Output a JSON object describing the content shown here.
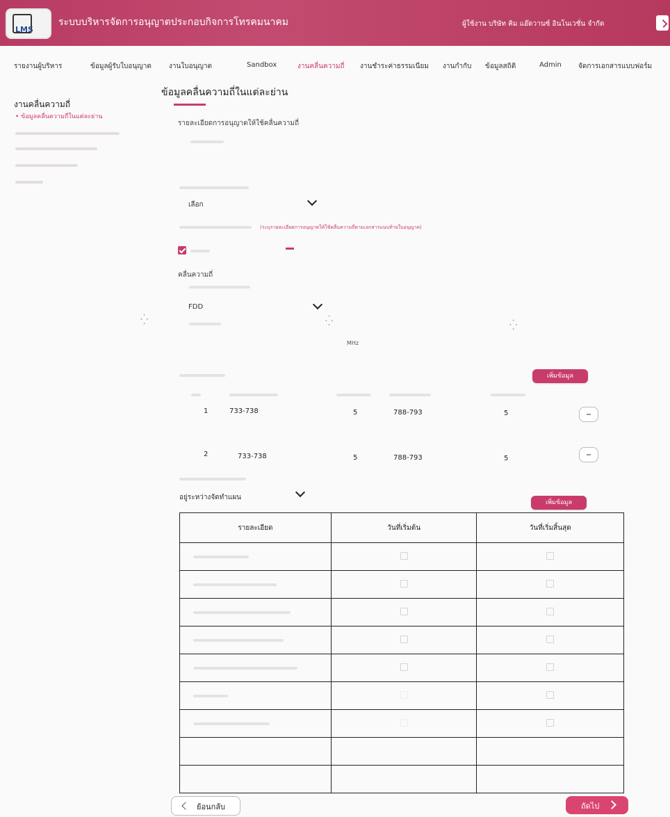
{
  "header": {
    "logo_text": "LMS",
    "system_title": "ระบบบริหารจัดการอนุญาตประกอบกิจการโทรคมนาคม",
    "user_info": "ผู้ใช้งาน บริษัท คิม แอ๊ดวานซ์ อินโนเวชั่น จำกัด"
  },
  "nav": {
    "items": [
      "รายงานผู้บริหาร",
      "ข้อมูลผู้รับใบอนุญาต",
      "งานใบอนุญาต",
      "Sandbox",
      "งานคลื่นความถี่",
      "งานชำระค่าธรรมเนียม",
      "งานกำกับ",
      "ข้อมูลสถิติ",
      "Admin",
      "จัดการเอกสารแบบฟอร์ม"
    ],
    "active": "งานคลื่นความถี่"
  },
  "sidebar": {
    "title": "งานคลื่นความถี่",
    "active_item": "• ข้อมูลคลื่นความถี่ในแต่ละย่าน"
  },
  "main": {
    "page_title": "ข้อมูลคลื่นความถี่ในแต่ละย่าน",
    "section_subtitle": "รายละเอียดการอนุญาตให้ใช้คลื่นความถี่",
    "select_1": "เลือก",
    "pink_note": "(ระบุรายละเอียดการอนุญาตให้ใช้คลื่นความถี่ตามเอกสารแนบท้ายใบอนุญาต)",
    "frequency_section": "คลื่นความถี่",
    "select_2": "FDD",
    "unit": "MHz",
    "add_button_1": "เพิ่มข้อมูล",
    "add_button_2": "เพิ่มข้อมูล",
    "status_select": "อยู่ระหว่างจัดทำแผน"
  },
  "freq_rows": [
    {
      "no": "1",
      "range1": "733-738",
      "bw1": "5",
      "range2": "788-793",
      "bw2": "5"
    },
    {
      "no": "2",
      "range1": "733-738",
      "bw1": "5",
      "range2": "788-793",
      "bw2": "5"
    }
  ],
  "table": {
    "headers": [
      "รายละเอียด",
      "วันที่เริ่มต้น",
      "วันที่เริ่มสิ้นสุด"
    ]
  },
  "footer": {
    "back_label": "ย้อนกลับ",
    "next_label": "ถัดไป"
  },
  "colors": {
    "brand": "#c93b6a",
    "header": "#b83b63"
  }
}
